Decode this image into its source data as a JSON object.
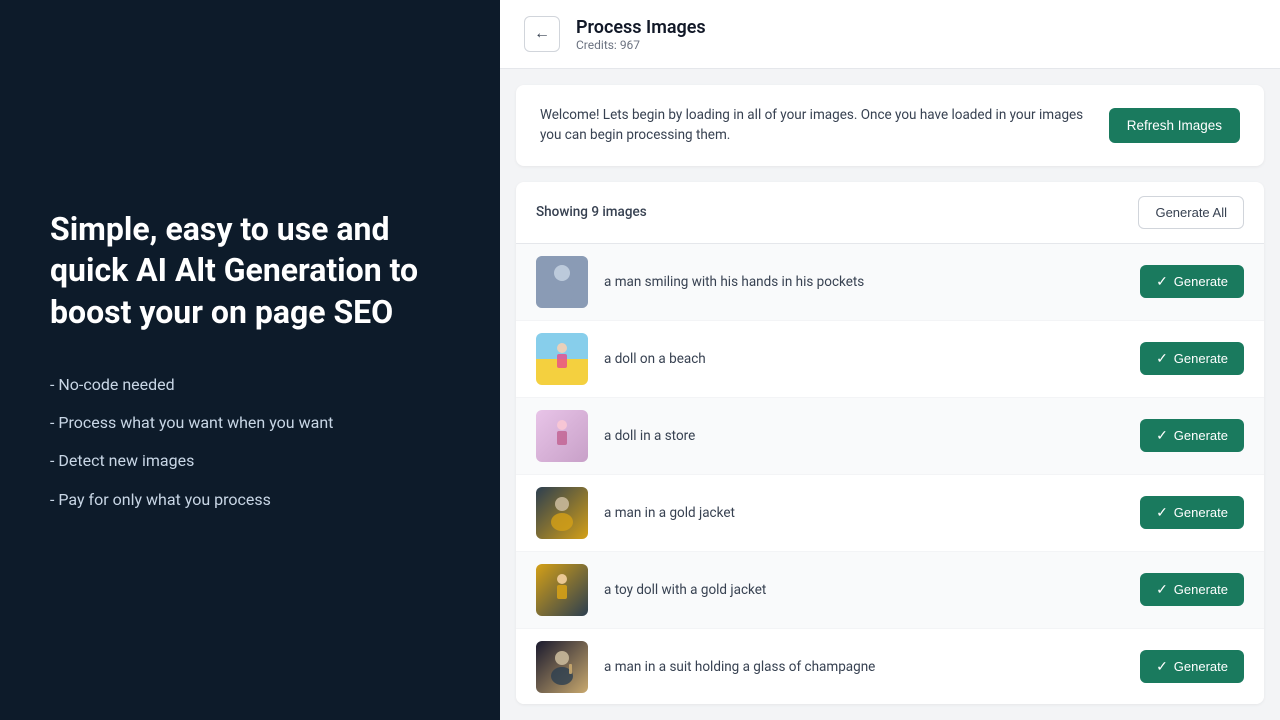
{
  "left": {
    "hero_title": "Simple, easy to use and quick AI Alt Generation to boost your on page SEO",
    "features": [
      {
        "text": "- No-code needed"
      },
      {
        "text": "- Process what you want when you want"
      },
      {
        "text": "- Detect new images"
      },
      {
        "text": "- Pay for only what you process"
      }
    ]
  },
  "header": {
    "back_label": "←",
    "title": "Process Images",
    "credits": "Credits: 967"
  },
  "welcome": {
    "message": "Welcome! Lets begin by loading in all of your images. Once you have loaded in your images you can begin processing them.",
    "refresh_button_label": "Refresh Images"
  },
  "images_section": {
    "count_label": "Showing 9 images",
    "generate_all_label": "Generate All",
    "images": [
      {
        "alt_text": "a man smiling with his hands in his pockets",
        "thumb_class": "thumb-person",
        "generate_label": "Generate"
      },
      {
        "alt_text": "a doll on a beach",
        "thumb_class": "thumb-doll-beach",
        "generate_label": "Generate"
      },
      {
        "alt_text": "a doll in a store",
        "thumb_class": "thumb-doll-store",
        "generate_label": "Generate"
      },
      {
        "alt_text": "a man in a gold jacket",
        "thumb_class": "thumb-gold-jacket",
        "generate_label": "Generate"
      },
      {
        "alt_text": "a toy doll with a gold jacket",
        "thumb_class": "thumb-toy-doll",
        "generate_label": "Generate"
      },
      {
        "alt_text": "a man in a suit holding a glass of champagne",
        "thumb_class": "thumb-champagne",
        "generate_label": "Generate"
      }
    ]
  },
  "colors": {
    "brand_green": "#1a7a5e",
    "dark_bg": "#0d1b2a"
  }
}
